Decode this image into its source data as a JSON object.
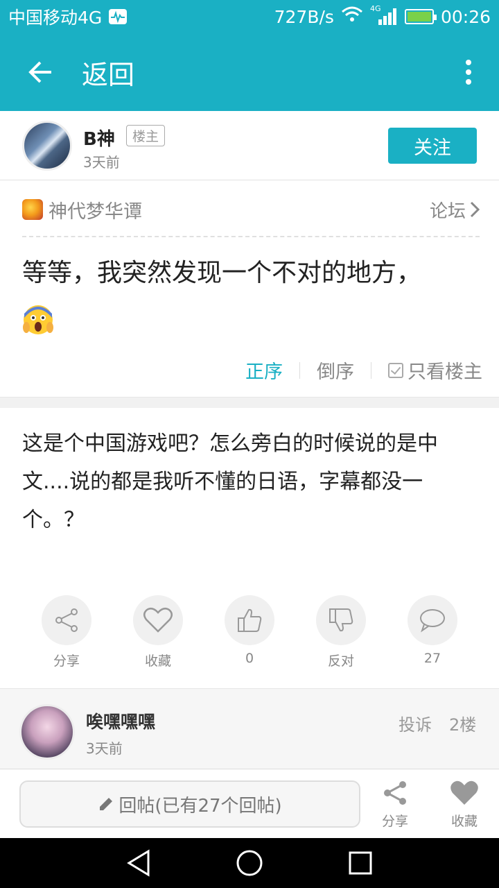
{
  "status_bar": {
    "carrier": "中国移动4G",
    "speed": "727B/s",
    "network": "4G",
    "time": "00:26"
  },
  "appbar": {
    "title": "返回",
    "back_icon": "arrow-left-icon",
    "more_icon": "more-vertical-icon"
  },
  "author": {
    "name": "B神",
    "badge": "楼主",
    "time": "3天前",
    "follow_label": "关注"
  },
  "post": {
    "forum_name": "神代梦华谭",
    "forum_link": "论坛",
    "title": "等等，我突然发现一个不对的地方，",
    "emoji": "scream-emoji-icon",
    "sort": {
      "asc": "正序",
      "desc": "倒序",
      "only_op": "只看楼主"
    }
  },
  "content": {
    "text": "这是个中国游戏吧？怎么旁白的时候说的是中文....说的都是我听不懂的日语，字幕都没一个。？"
  },
  "actions": [
    {
      "icon": "share-icon",
      "label": "分享"
    },
    {
      "icon": "heart-icon",
      "label": "收藏"
    },
    {
      "icon": "thumbs-up-icon",
      "label": "0"
    },
    {
      "icon": "thumbs-down-icon",
      "label": "反对"
    },
    {
      "icon": "comment-icon",
      "label": "27"
    }
  ],
  "reply": {
    "name": "唉嘿嘿嘿",
    "time": "3天前",
    "report": "投诉",
    "floor": "2楼"
  },
  "bottom_bar": {
    "reply_placeholder": "回帖(已有27个回帖)",
    "share_label": "分享",
    "favorite_label": "收藏"
  },
  "colors": {
    "accent": "#1ab0c4",
    "text_primary": "#222222",
    "text_muted": "#888888"
  }
}
